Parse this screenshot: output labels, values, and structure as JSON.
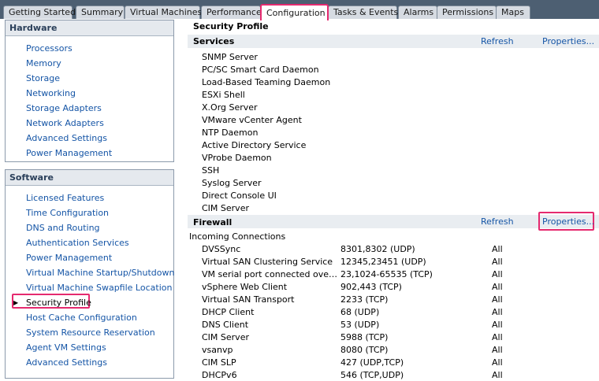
{
  "tabs": [
    {
      "label": "Getting Started",
      "active": false
    },
    {
      "label": "Summary",
      "active": false
    },
    {
      "label": "Virtual Machines",
      "active": false
    },
    {
      "label": "Performance",
      "active": false
    },
    {
      "label": "Configuration",
      "active": true
    },
    {
      "label": "Tasks & Events",
      "active": false
    },
    {
      "label": "Alarms",
      "active": false
    },
    {
      "label": "Permissions",
      "active": false
    },
    {
      "label": "Maps",
      "active": false
    }
  ],
  "hardware": {
    "title": "Hardware",
    "items": [
      "Processors",
      "Memory",
      "Storage",
      "Networking",
      "Storage Adapters",
      "Network Adapters",
      "Advanced Settings",
      "Power Management"
    ]
  },
  "software": {
    "title": "Software",
    "items": [
      "Licensed Features",
      "Time Configuration",
      "DNS and Routing",
      "Authentication Services",
      "Power Management",
      "Virtual Machine Startup/Shutdown",
      "Virtual Machine Swapfile Location",
      "Security Profile",
      "Host Cache Configuration",
      "System Resource Reservation",
      "Agent VM Settings",
      "Advanced Settings"
    ],
    "selected": "Security Profile"
  },
  "content": {
    "page_title": "Security Profile",
    "services": {
      "title": "Services",
      "refresh": "Refresh",
      "properties": "Properties...",
      "items": [
        "SNMP Server",
        "PC/SC Smart Card Daemon",
        "Load-Based Teaming Daemon",
        "ESXi Shell",
        "X.Org Server",
        "VMware vCenter Agent",
        "NTP Daemon",
        "Active Directory Service",
        "VProbe Daemon",
        "SSH",
        "Syslog Server",
        "Direct Console UI",
        "CIM Server"
      ]
    },
    "firewall": {
      "title": "Firewall",
      "refresh": "Refresh",
      "properties": "Properties...",
      "incoming_label": "Incoming Connections",
      "rows": [
        {
          "name": "DVSSync",
          "ports": "8301,8302 (UDP)",
          "allowed": "All"
        },
        {
          "name": "Virtual SAN Clustering Service",
          "ports": "12345,23451 (UDP)",
          "allowed": "All"
        },
        {
          "name": "VM serial port connected over ne...",
          "ports": "23,1024-65535 (TCP)",
          "allowed": "All"
        },
        {
          "name": "vSphere Web Client",
          "ports": "902,443 (TCP)",
          "allowed": "All"
        },
        {
          "name": "Virtual SAN Transport",
          "ports": "2233 (TCP)",
          "allowed": "All"
        },
        {
          "name": "DHCP Client",
          "ports": "68 (UDP)",
          "allowed": "All"
        },
        {
          "name": "DNS Client",
          "ports": "53 (UDP)",
          "allowed": "All"
        },
        {
          "name": "CIM Server",
          "ports": "5988 (TCP)",
          "allowed": "All"
        },
        {
          "name": "vsanvp",
          "ports": "8080 (TCP)",
          "allowed": "All"
        },
        {
          "name": "CIM SLP",
          "ports": "427 (UDP,TCP)",
          "allowed": "All"
        },
        {
          "name": "DHCPv6",
          "ports": "546 (TCP,UDP)",
          "allowed": "All"
        }
      ]
    }
  },
  "colors": {
    "highlight": "#e52a6f",
    "link": "#1555a6",
    "tabbar": "#4d5f72"
  }
}
